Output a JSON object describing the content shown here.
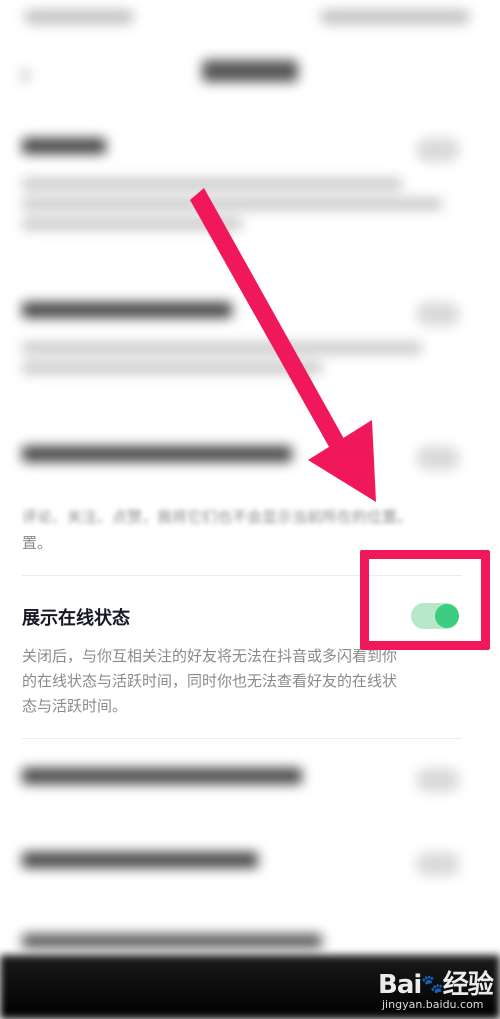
{
  "previous_item": {
    "description_tail": "评论、关注、点赞，我将它们也不会显示当前所在的位置。",
    "description_line2": "置。"
  },
  "online_status": {
    "title": "展示在线状态",
    "description": [
      "关闭后，与你互相关注的好友将无法在抖音或多闪看到你",
      "的在线状态与活跃时间，同时你也无法查看好友的在线状",
      "态与活跃时间。"
    ],
    "toggle_on": true
  },
  "colors": {
    "toggle_track": "#b6e8c9",
    "toggle_knob": "#3dcd7e",
    "annotation": "#f0185a"
  },
  "watermark": {
    "logo_prefix": "Bai",
    "logo_suffix": "经验",
    "url": "jingyan.baidu.com"
  },
  "icons": {
    "back": "chevron-left-icon",
    "paw": "paw-icon"
  }
}
